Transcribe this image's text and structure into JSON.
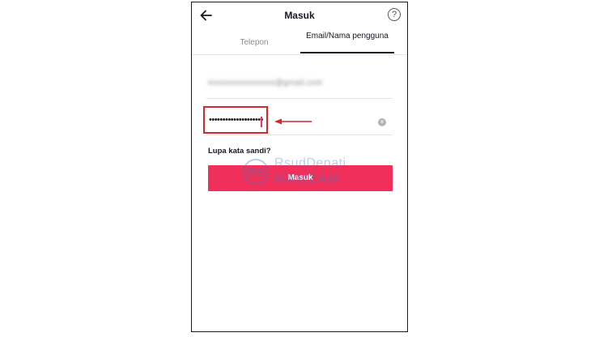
{
  "header": {
    "title": "Masuk",
    "help_symbol": "?",
    "back_icon": "arrow-left-icon",
    "help_icon": "question-circle-icon"
  },
  "tabs": [
    {
      "label": "Telepon",
      "active": false
    },
    {
      "label": "Email/Nama pengguna",
      "active": true
    }
  ],
  "form": {
    "email_value": "mxxxxxxxxxxxxxx@gmail.com",
    "password_value": "••••••••••••••••••••",
    "clear_symbol": "×",
    "forgot_label": "Lupa kata sandi?",
    "login_label": "Masuk"
  },
  "watermark": {
    "logo_text": "RS",
    "line1": "RsudDepati",
    "line2": "HAMZAH"
  },
  "colors": {
    "accent": "#f0305a",
    "annotation": "#d4262c",
    "text": "#161823",
    "muted": "#8a8b91"
  }
}
